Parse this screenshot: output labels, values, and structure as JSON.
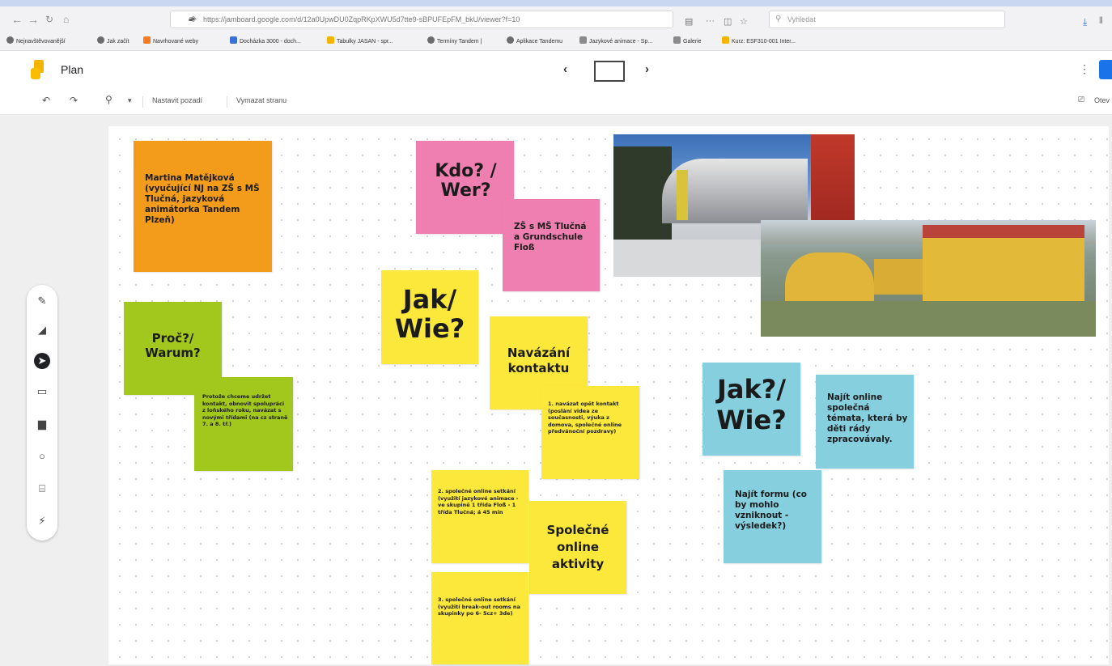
{
  "browser": {
    "url": "https://jamboard.google.com/d/12a0UpwDU0ZqpRKpXWU5d7tte9-sBPUFEpFM_bkU/viewer?f=10",
    "search_placeholder": "Vyhledat",
    "bookmarks": [
      {
        "label": "Nejnavštěvovanější",
        "color": "#6b6b6b"
      },
      {
        "label": "Jak začít",
        "color": "#6b6b6b"
      },
      {
        "label": "Navrhované weby",
        "color": "#f47b20"
      },
      {
        "label": "Docházka 3000 - doch...",
        "color": "#3b6fd6"
      },
      {
        "label": "Tabulky JASAN - spr...",
        "color": "#f4b400"
      },
      {
        "label": "Termíny Tandem |",
        "color": "#6b6b6b"
      },
      {
        "label": "Aplikace Tandemu",
        "color": "#6b6b6b"
      },
      {
        "label": "Jazykové animace - Sp...",
        "color": "#8a8a8a"
      },
      {
        "label": "Galerie",
        "color": "#8a8a8a"
      },
      {
        "label": "Kurz: ESF310-001 Inter...",
        "color": "#f4b400"
      }
    ]
  },
  "app": {
    "title": "Plan",
    "frame_label": "",
    "toolbar": {
      "set_background": "Nastavit pozadí",
      "clear_frame": "Vymazat stranu",
      "present": "Otev"
    }
  },
  "side_tools": [
    "pen-icon",
    "eraser-icon",
    "select-icon",
    "sticky-note-icon",
    "image-icon",
    "circle-icon",
    "textbox-icon",
    "laser-icon"
  ],
  "notes": {
    "n1": "Martina Matějková (vyučující NJ na ZŠ s MŠ Tlučná, jazyková animátorka Tandem Plzeň)",
    "n2": "Kdo? / Wer?",
    "n3": "ZŠ s MŠ Tlučná a Grundschule Floß",
    "n4": "Jak/ Wie?",
    "n5": "Proč?/ Warum?",
    "n6": "Protože chceme udržet kontakt, obnovit spolupráci z loňského roku, navázat s novými třídami (na cz straně 7. a 8. tř.)",
    "n7": "Navázání kontaktu",
    "n8": "1. navázat opět kontakt (poslání videa ze současnosti, výuka z domova, společné online předvánoční pozdravy)",
    "n9": "2. společné online setkání (využití jazykové animace - ve skupině 1 třída Floß - 1 třída Tlučná; á 45 min",
    "n10": "Společné online aktivity",
    "n11": "3. společné online setkání (využití break-out rooms na skupinky po 6- 5cz+ 3de)",
    "n12": "Jak?/ Wie?",
    "n13": "Najít online společná témata, která by děti rády zpracovávaly.",
    "n14": "Najít formu (co by mohlo vzniknout - výsledek?)"
  },
  "colors": {
    "orange": "#f39c1b",
    "pink": "#ee7fb0",
    "yellow": "#fbe83a",
    "green": "#a3c81d",
    "cyan": "#85cfdf",
    "accent": "#1a73e8"
  }
}
